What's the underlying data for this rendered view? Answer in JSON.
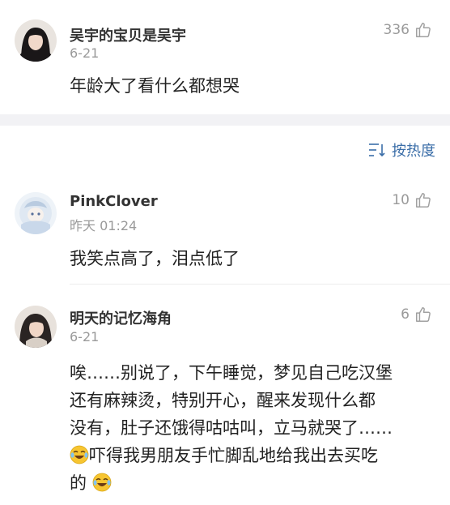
{
  "comments": [
    {
      "username": "吴宇的宝贝是吴宇",
      "date": "6-21",
      "likes": "336",
      "text": "年龄大了看什么都想哭"
    },
    {
      "username": "PinkClover",
      "date": "昨天 01:24",
      "likes": "10",
      "text": "我笑点高了，泪点低了"
    },
    {
      "username": "明天的记忆海角",
      "date": "6-21",
      "likes": "6",
      "text_line1": "唉……别说了，下午睡觉，梦见自己吃汉堡",
      "text_line2": "还有麻辣烫，特别开心，醒来发现什么都",
      "text_line3": "没有，肚子还饿得咕咕叫，立马就哭了……",
      "text_line4": "吓得我男朋友手忙脚乱地给我出去买吃",
      "text_line5": "的"
    }
  ],
  "sort": {
    "label": "按热度"
  },
  "icons": {
    "like": "thumbs-up-icon",
    "sort": "sort-icon",
    "emoji": "crying-laughing-emoji"
  },
  "colors": {
    "accent": "#3b6ea8",
    "muted": "#9a9a9a",
    "band": "#f2f2f5"
  }
}
